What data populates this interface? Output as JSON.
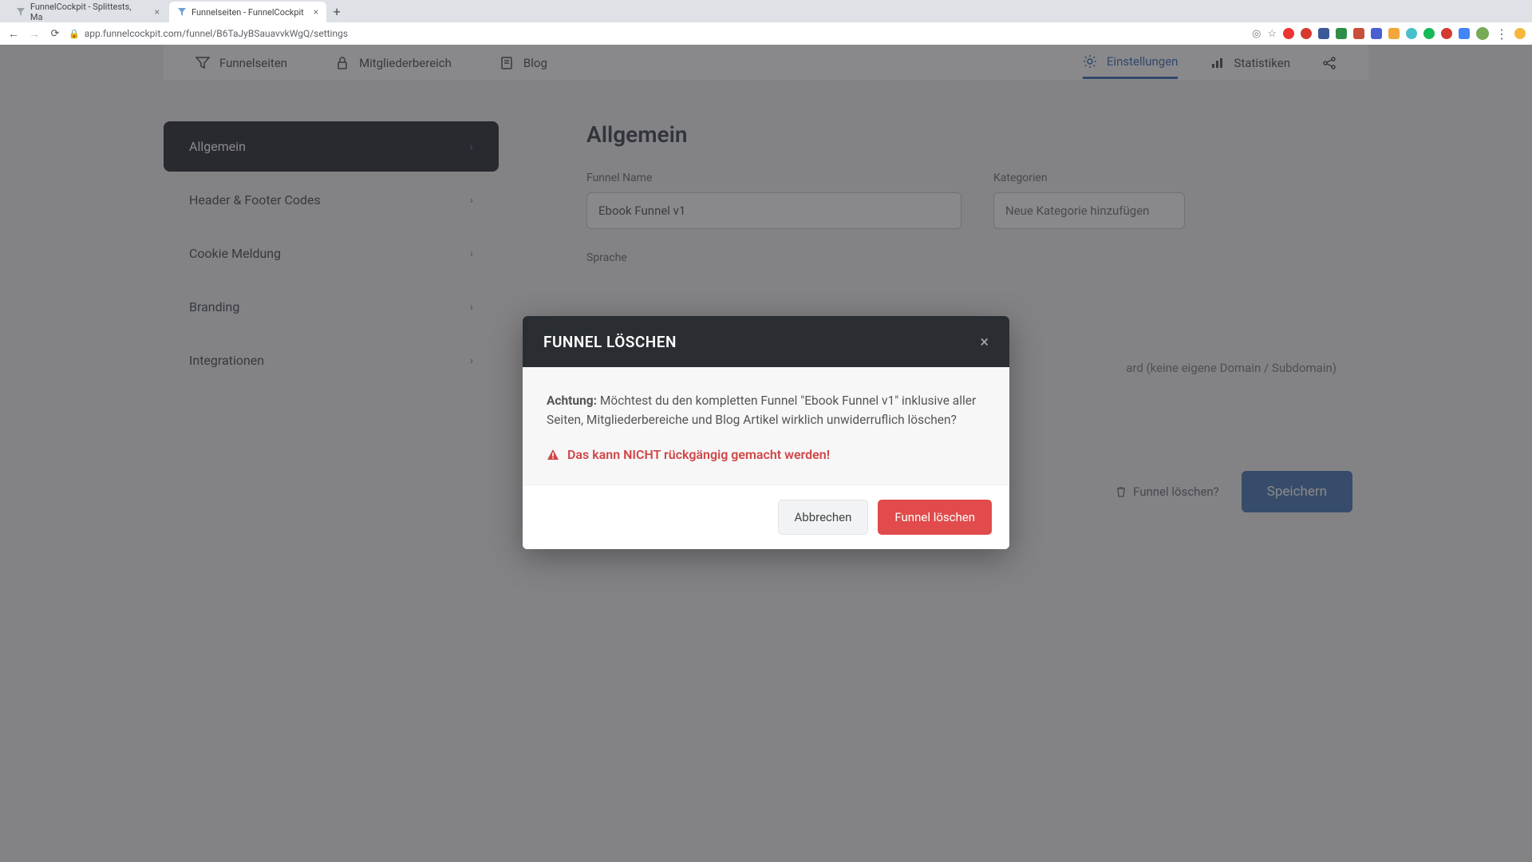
{
  "browser": {
    "tabs": [
      {
        "title": "FunnelCockpit - Splittests, Ma",
        "active": false
      },
      {
        "title": "Funnelseiten - FunnelCockpit",
        "active": true
      }
    ],
    "url": "app.funnelcockpit.com/funnel/B6TaJyBSauavvkWgQ/settings"
  },
  "topnav": {
    "left": [
      {
        "label": "Funnelseiten",
        "icon": "funnel-icon"
      },
      {
        "label": "Mitgliederbereich",
        "icon": "lock-icon"
      },
      {
        "label": "Blog",
        "icon": "note-icon"
      }
    ],
    "right": [
      {
        "label": "Einstellungen",
        "icon": "gear-icon",
        "active": true
      },
      {
        "label": "Statistiken",
        "icon": "chart-icon",
        "active": false
      }
    ]
  },
  "sidebar": {
    "items": [
      {
        "label": "Allgemein",
        "active": true
      },
      {
        "label": "Header & Footer Codes",
        "active": false
      },
      {
        "label": "Cookie Meldung",
        "active": false
      },
      {
        "label": "Branding",
        "active": false
      },
      {
        "label": "Integrationen",
        "active": false
      }
    ]
  },
  "main": {
    "title": "Allgemein",
    "funnel_name_label": "Funnel Name",
    "funnel_name_value": "Ebook Funnel v1",
    "categories_label": "Kategorien",
    "categories_placeholder": "Neue Kategorie hinzufügen",
    "language_label": "Sprache",
    "domain_hint_suffix": "(keine eigene Domain / Subdomain)",
    "domain_hint_prefix": "ard ",
    "delete_link": "Funnel löschen?",
    "save_label": "Speichern"
  },
  "modal": {
    "title": "FUNNEL LÖSCHEN",
    "attention_label": "Achtung:",
    "body_text": "Möchtest du den kompletten Funnel \"Ebook Funnel v1\" inklusive aller Seiten, Mitgliederbereiche und Blog Artikel wirklich unwiderruflich löschen?",
    "warning_text": "Das kann NICHT rückgängig gemacht werden!",
    "cancel_label": "Abbrechen",
    "confirm_label": "Funnel löschen"
  },
  "colors": {
    "accent": "#4a78b3",
    "danger": "#e14b4b",
    "dark": "#2a2e33"
  }
}
